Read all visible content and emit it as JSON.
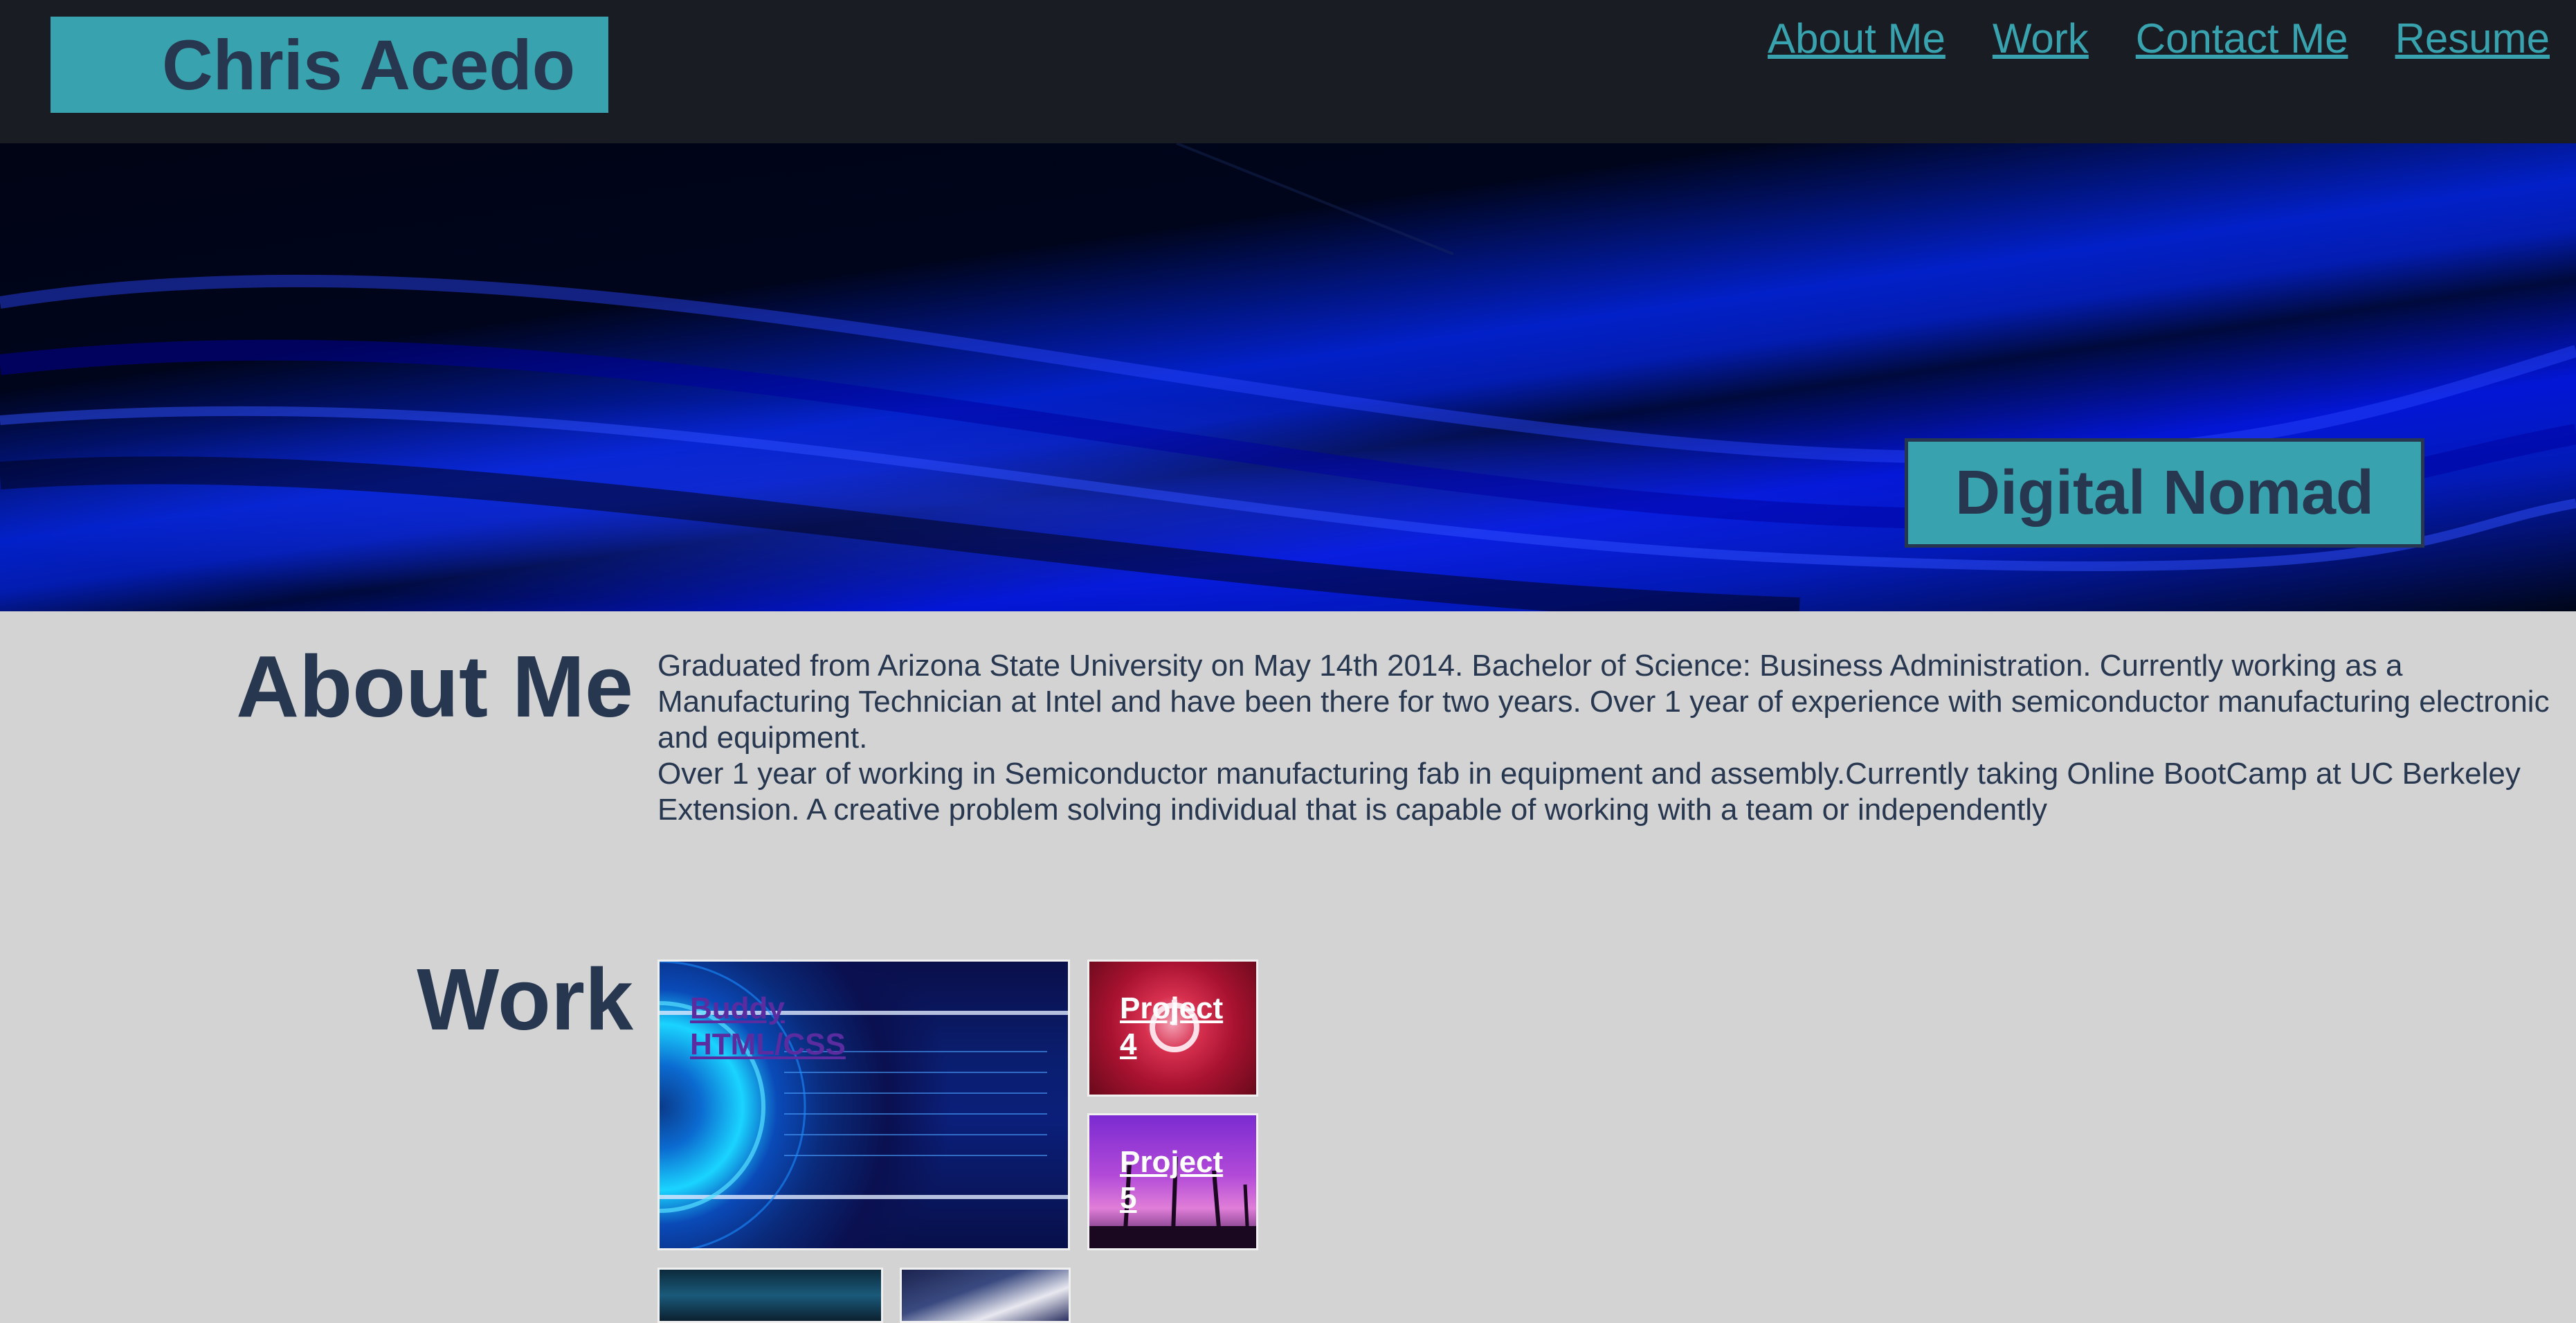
{
  "header": {
    "logo_text": "Chris Acedo",
    "nav": [
      {
        "label": "About Me"
      },
      {
        "label": "Work"
      },
      {
        "label": "Contact Me"
      },
      {
        "label": "Resume"
      }
    ]
  },
  "hero": {
    "tagline": "Digital Nomad"
  },
  "about": {
    "heading": "About Me",
    "paragraphs": [
      "Graduated from Arizona State University on May 14th 2014. Bachelor of Science: Business Administration. Currently working as a Manufacturing Technician at Intel and have been there for two years. Over 1 year of experience with semiconductor manufacturing electronic and equipment.",
      "Over 1 year of working in Semiconductor manufacturing fab in equipment and assembly.Currently taking Online BootCamp at UC Berkeley Extension. A creative problem solving individual that is capable of working with a team or independently"
    ]
  },
  "work": {
    "heading": "Work",
    "projects": [
      {
        "label": "Buddy HTML/CSS"
      },
      {
        "label": "Project 4"
      },
      {
        "label": "Project 5"
      }
    ]
  },
  "colors": {
    "accent": "#38a3ae",
    "dark_text": "#283750",
    "header_bg": "#1a1c23",
    "page_bg": "#d3d3d3"
  }
}
